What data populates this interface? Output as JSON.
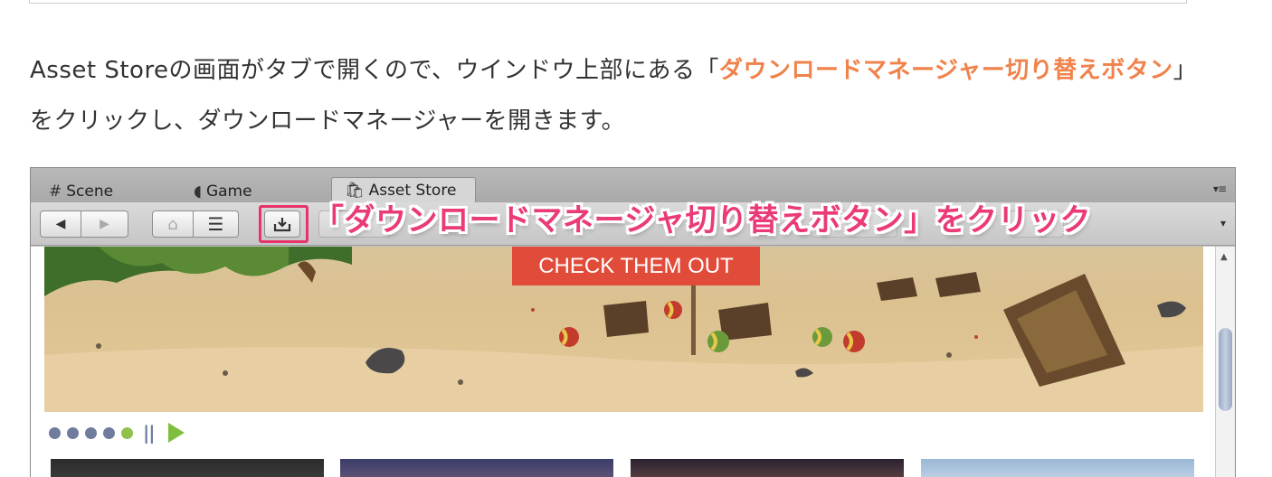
{
  "article": {
    "text_before": "Asset Storeの画面がタブで開くので、ウインドウ上部にある「",
    "highlight": "ダウンロードマネージャー切り替えボタン",
    "text_after": "」をクリックし、ダウンロードマネージャーを開きます。",
    "highlight_color": "#f0824b"
  },
  "window": {
    "tabs": [
      {
        "label": "Scene",
        "icon": "hash-icon",
        "glyph": "#"
      },
      {
        "label": "Game",
        "icon": "pacman-icon",
        "glyph": "◖"
      },
      {
        "label": "Asset Store",
        "icon": "shopping-bag-icon",
        "glyph": "🛍",
        "active": true
      }
    ],
    "toolbar": {
      "back_glyph": "◀",
      "forward_glyph": "▶",
      "home_glyph": "⌂",
      "list_glyph": "☰",
      "download_glyph": "⤓",
      "dropdown_glyph": "▾"
    },
    "annotation": "「ダウンロードマネージャ切り替えボタン」をクリック",
    "annotation_color": "#ea3a78",
    "banner": {
      "cta": "CHECK THEM OUT",
      "cta_color": "#e14b3a"
    },
    "carousel": {
      "dots": 5,
      "active_dot": 4,
      "pause_glyph": "||"
    }
  }
}
